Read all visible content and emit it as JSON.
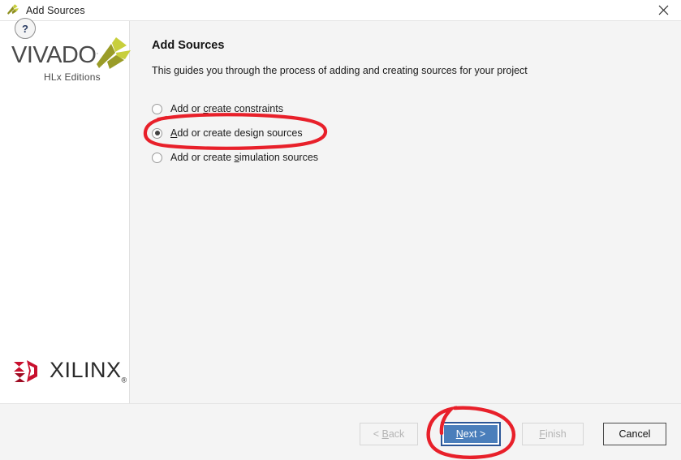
{
  "window": {
    "title": "Add Sources",
    "icon": "vivado-logo-icon",
    "close_label": "✕"
  },
  "sidebar": {
    "product_name": "VIVADO",
    "product_tm": ".",
    "product_edition": "HLx Editions",
    "vendor_name": "XILINX",
    "vendor_tm": "®"
  },
  "main": {
    "title": "Add Sources",
    "description": "This guides you through the process of adding and creating sources for your project",
    "options": [
      {
        "id": "add-or-create-constraints",
        "pre": "Add or ",
        "mnemonic": "c",
        "post": "reate constraints",
        "selected": false
      },
      {
        "id": "add-or-create-design-sources",
        "pre": "",
        "mnemonic": "A",
        "post": "dd or create design sources",
        "selected": true
      },
      {
        "id": "add-or-create-simulation-sources",
        "pre": "Add or create ",
        "mnemonic": "s",
        "post": "imulation sources",
        "selected": false
      }
    ]
  },
  "footer": {
    "help_label": "?",
    "buttons": [
      {
        "id": "back",
        "pre": "< ",
        "mnemonic": "B",
        "post": "ack",
        "state": "disabled"
      },
      {
        "id": "next",
        "pre": "",
        "mnemonic": "N",
        "post": "ext >",
        "state": "default"
      },
      {
        "id": "finish",
        "pre": "",
        "mnemonic": "F",
        "post": "inish",
        "state": "disabled"
      },
      {
        "id": "cancel",
        "pre": "Cancel",
        "mnemonic": "",
        "post": "",
        "state": "normal"
      }
    ]
  },
  "annotations": {
    "color": "#e8202a",
    "items": [
      {
        "name": "design-sources-option-highlight",
        "shape": "ellipse"
      },
      {
        "name": "next-button-highlight",
        "shape": "ellipse"
      }
    ]
  },
  "colors": {
    "accent_blue": "#4a7ebb",
    "accent_blue_border": "#2b5597",
    "annotation_red": "#e8202a",
    "vivado_green": "#c8cf3c",
    "vivado_olive": "#8f9020",
    "xilinx_red": "#c8102e",
    "panel_bg": "#f4f4f4",
    "sidebar_bg": "#ffffff"
  }
}
